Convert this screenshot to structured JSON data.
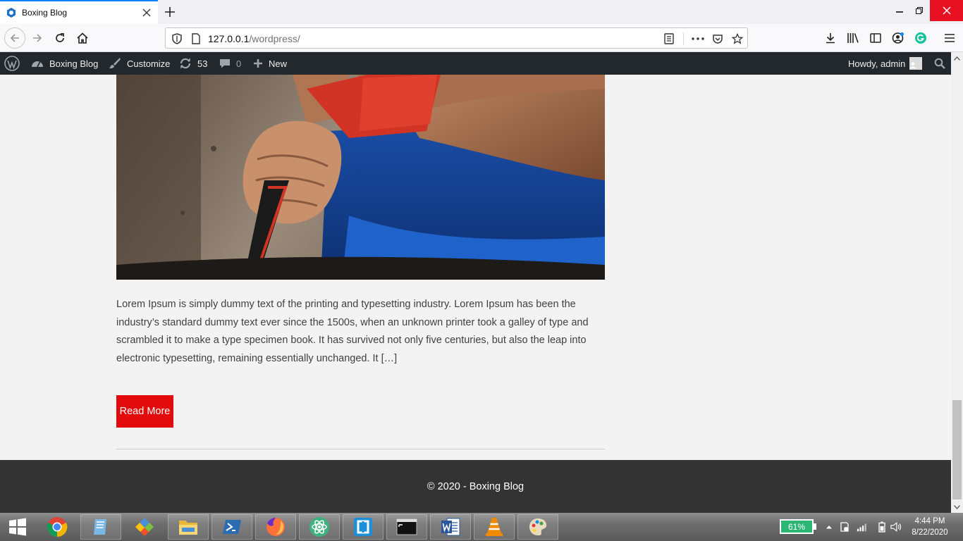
{
  "browser": {
    "tab_title": "Boxing Blog",
    "url_host": "127.0.0.1",
    "url_path": "/wordpress/"
  },
  "adminbar": {
    "site_name": "Boxing Blog",
    "customize": "Customize",
    "updates_count": "53",
    "comments_count": "0",
    "new_label": "New",
    "howdy": "Howdy, admin"
  },
  "post": {
    "excerpt": "Lorem Ipsum is simply dummy text of the printing and typesetting industry. Lorem Ipsum has been the industry’s standard dummy text ever since the 1500s, when an unknown printer took a galley of type and scrambled it to make a type specimen book. It has survived not only five centuries, but also the leap into electronic typesetting, remaining essentially unchanged. It […]",
    "read_more": "Read More"
  },
  "footer": {
    "copyright": "© 2020 - Boxing Blog"
  },
  "taskbar": {
    "battery": "61%",
    "time": "4:44 PM",
    "date": "8/22/2020"
  },
  "colors": {
    "admin_bar": "#23282d",
    "read_more_button": "#e20a0a",
    "footer": "#333333",
    "accent": "#0a84ff"
  }
}
